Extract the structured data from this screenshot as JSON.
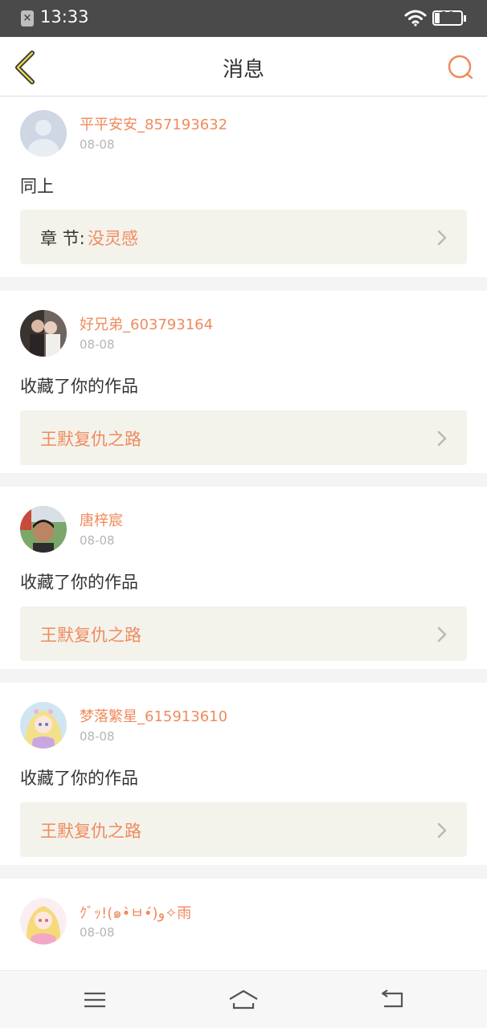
{
  "status_bar": {
    "time": "13:33",
    "battery_level": "19",
    "notification_icon": "notification-blocked-icon",
    "wifi_icon": "wifi-icon"
  },
  "header": {
    "title": "消息",
    "back_icon": "chevron-left-icon",
    "search_icon": "search-icon",
    "accent_color": "#f08a5d"
  },
  "messages": [
    {
      "username": "平平安安_857193632",
      "date": "08-08",
      "action": "同上",
      "link_prefix": "章 节:",
      "link_title": "没灵感",
      "avatar": "default-avatar"
    },
    {
      "username": "好兄弟_603793164",
      "date": "08-08",
      "action": "收藏了你的作品",
      "link_prefix": "",
      "link_title": "王默复仇之路",
      "avatar": "photo-avatar"
    },
    {
      "username": "唐梓宸",
      "date": "08-08",
      "action": "收藏了你的作品",
      "link_prefix": "",
      "link_title": "王默复仇之路",
      "avatar": "photo-avatar"
    },
    {
      "username": "梦落繁星_615913610",
      "date": "08-08",
      "action": "收藏了你的作品",
      "link_prefix": "",
      "link_title": "王默复仇之路",
      "avatar": "anime-avatar"
    },
    {
      "username": "ｸﾞｯ!(๑•̀ㅂ•́)و✧雨",
      "date": "08-08",
      "action": "",
      "link_prefix": "",
      "link_title": "",
      "avatar": "anime-avatar"
    }
  ],
  "bottom_nav": {
    "menu_icon": "menu-icon",
    "home_icon": "home-icon",
    "back_icon": "back-arrow-icon"
  }
}
